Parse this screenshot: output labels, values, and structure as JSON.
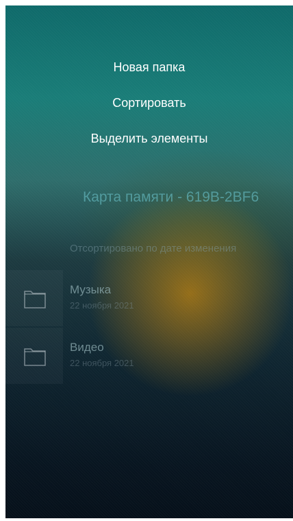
{
  "menu": {
    "items": [
      {
        "label": "Новая папка"
      },
      {
        "label": "Сортировать"
      },
      {
        "label": "Выделить элементы"
      }
    ]
  },
  "storage": {
    "title": "Карта памяти - 619B-2BF6",
    "sort_label": "Отсортировано по дате изменения"
  },
  "folders": [
    {
      "name": "Музыка",
      "date": "22 ноября 2021",
      "icon": "folder-icon"
    },
    {
      "name": "Видео",
      "date": "22 ноября 2021",
      "icon": "folder-icon"
    }
  ],
  "colors": {
    "menu_text": "#ffffff",
    "storage_title": "#5fafb4",
    "background_top": "#0f6a6a",
    "background_bottom": "#06101a"
  }
}
